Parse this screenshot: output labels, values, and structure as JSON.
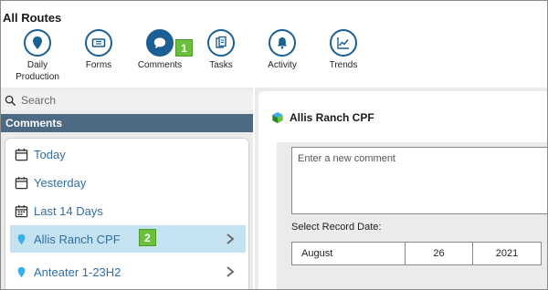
{
  "app": {
    "title": "All Routes"
  },
  "toolbar": {
    "items": [
      {
        "label": "Daily\nProduction",
        "icon": "location-pin-icon"
      },
      {
        "label": "Forms",
        "icon": "ticket-icon"
      },
      {
        "label": "Comments",
        "icon": "speech-bubble-icon",
        "active": true
      },
      {
        "label": "Tasks",
        "icon": "clipboard-icon"
      },
      {
        "label": "Activity",
        "icon": "bell-icon"
      },
      {
        "label": "Trends",
        "icon": "line-chart-icon"
      }
    ]
  },
  "badges": {
    "step1": "1",
    "step2": "2"
  },
  "search": {
    "placeholder": "Search"
  },
  "sidebar": {
    "section_title": "Comments",
    "items": [
      {
        "label": "Today",
        "icon": "calendar-icon"
      },
      {
        "label": "Yesterday",
        "icon": "calendar-icon"
      },
      {
        "label": "Last 14 Days",
        "icon": "calendar-range-icon"
      },
      {
        "label": "Allis Ranch CPF",
        "icon": "location-pin-icon",
        "selected": true
      },
      {
        "label": "Anteater 1-23H2",
        "icon": "location-pin-icon"
      }
    ]
  },
  "detail": {
    "title": "Allis Ranch CPF",
    "title_icon": "cube-icon",
    "comment_placeholder": "Enter a new comment",
    "record_date_label": "Select Record Date:",
    "date": {
      "month": "August",
      "day": "26",
      "year": "2021"
    }
  },
  "colors": {
    "primary": "#1b5f93",
    "header": "#4d6a85",
    "selected": "#c4e2f0",
    "link": "#2f6fa5",
    "badge": "#6abf3d",
    "pin": "#3ab0e8"
  }
}
